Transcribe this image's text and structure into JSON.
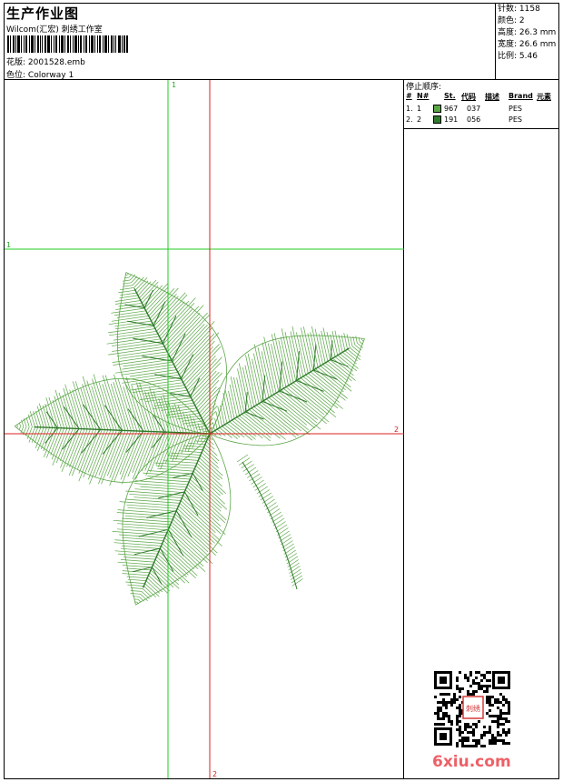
{
  "header": {
    "title": "生产作业图",
    "company": "Wilcom(汇宏) 刺绣工作室",
    "design_label": "花版:",
    "design_file": "2001528.emb",
    "colorway_label": "色位:",
    "colorway_name": "Colorway 1"
  },
  "info": {
    "stitches": "针数: 1158",
    "colors": "颜色: 2",
    "height": "高度: 26.3 mm",
    "width": "宽度: 26.6 mm",
    "scale": "比例: 5.46"
  },
  "stop_sequence": {
    "title": "停止顺序:",
    "headers": [
      "#",
      "N#",
      "St.",
      "代码",
      "描述",
      "Brand",
      "元素"
    ],
    "rows": [
      {
        "idx": "1.",
        "n": "1",
        "color": "#5aa646",
        "stitches": "967",
        "code": "037",
        "brand": "PES"
      },
      {
        "idx": "2.",
        "n": "2",
        "color": "#2f7a2b",
        "stitches": "191",
        "code": "056",
        "brand": "PES"
      }
    ]
  },
  "guides": {
    "green_v": "1",
    "green_h": "1",
    "red_h": "2",
    "red_v": "2"
  },
  "colors": {
    "leaf_light": "#5aa646",
    "leaf_dark": "#2f7a2b",
    "guide_green": "#22cc22",
    "guide_red": "#dd2222"
  },
  "watermark": "6xiu.com",
  "seal_text": "刺绣"
}
